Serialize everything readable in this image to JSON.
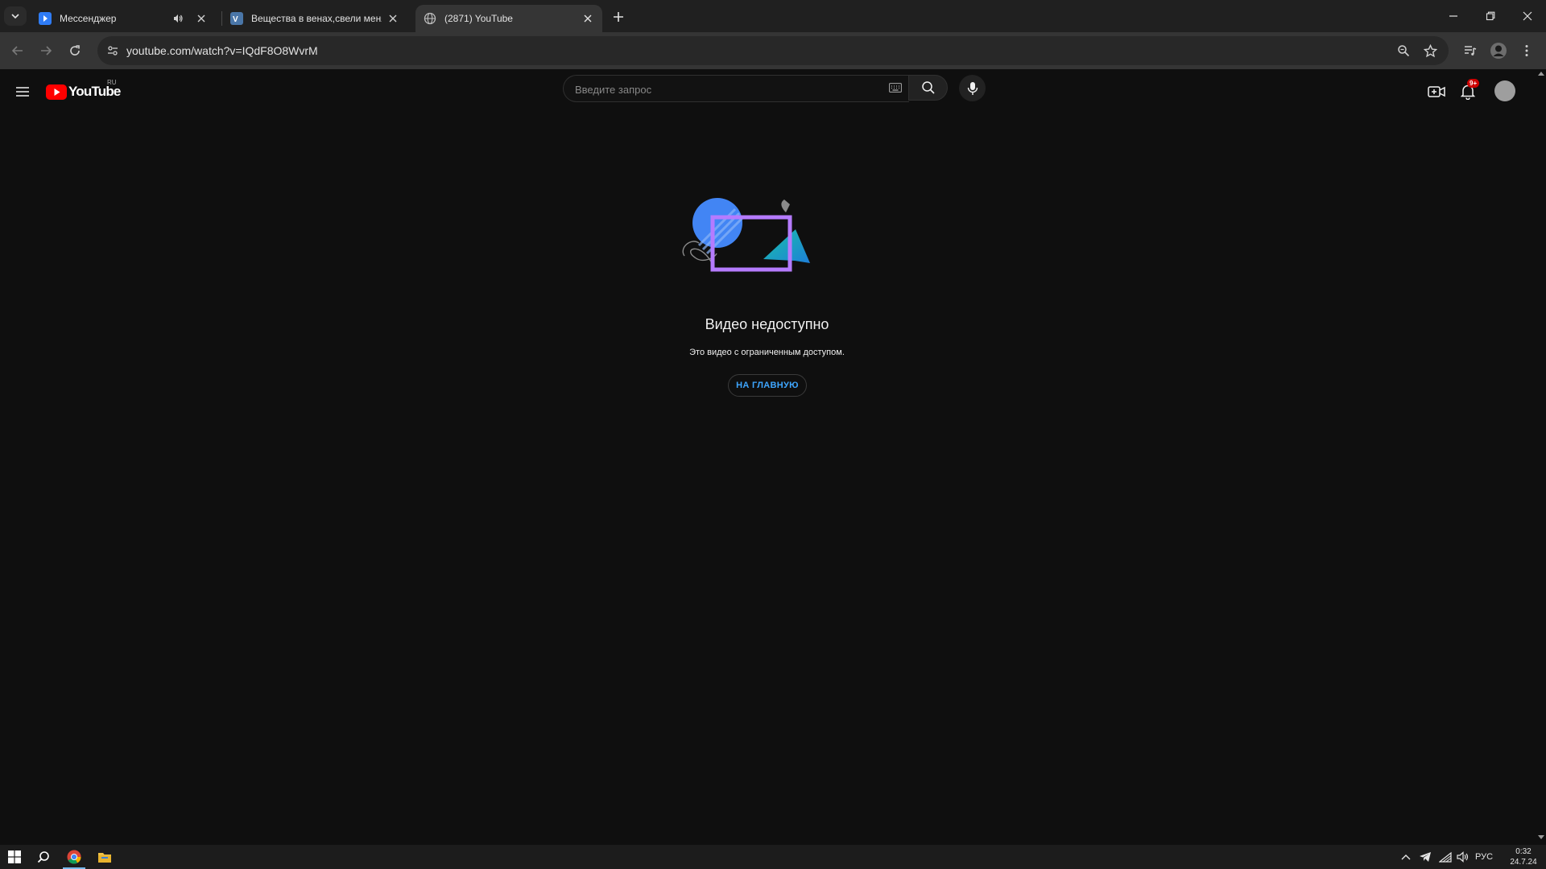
{
  "browser": {
    "tabs": [
      {
        "title": "Мессенджер",
        "favicon": "messenger-icon",
        "audio": true,
        "active": false
      },
      {
        "title": "Вещества в венах,свели меня с у",
        "favicon": "vk-icon",
        "audio": false,
        "active": false
      },
      {
        "title": "(2871) YouTube",
        "favicon": "globe-icon",
        "audio": false,
        "active": true
      }
    ],
    "url": "youtube.com/watch?v=IQdF8O8WvrM"
  },
  "youtube": {
    "logo_text": "YouTube",
    "region": "RU",
    "search_placeholder": "Введите запрос",
    "notifications_badge": "9+",
    "accent": "#ff0000"
  },
  "main": {
    "error_title": "Видео недоступно",
    "error_message": "Это видео с ограниченным доступом.",
    "home_button": "НА ГЛАВНУЮ"
  },
  "taskbar": {
    "language": "РУС",
    "time": "0:32",
    "date": "24.7.24"
  }
}
